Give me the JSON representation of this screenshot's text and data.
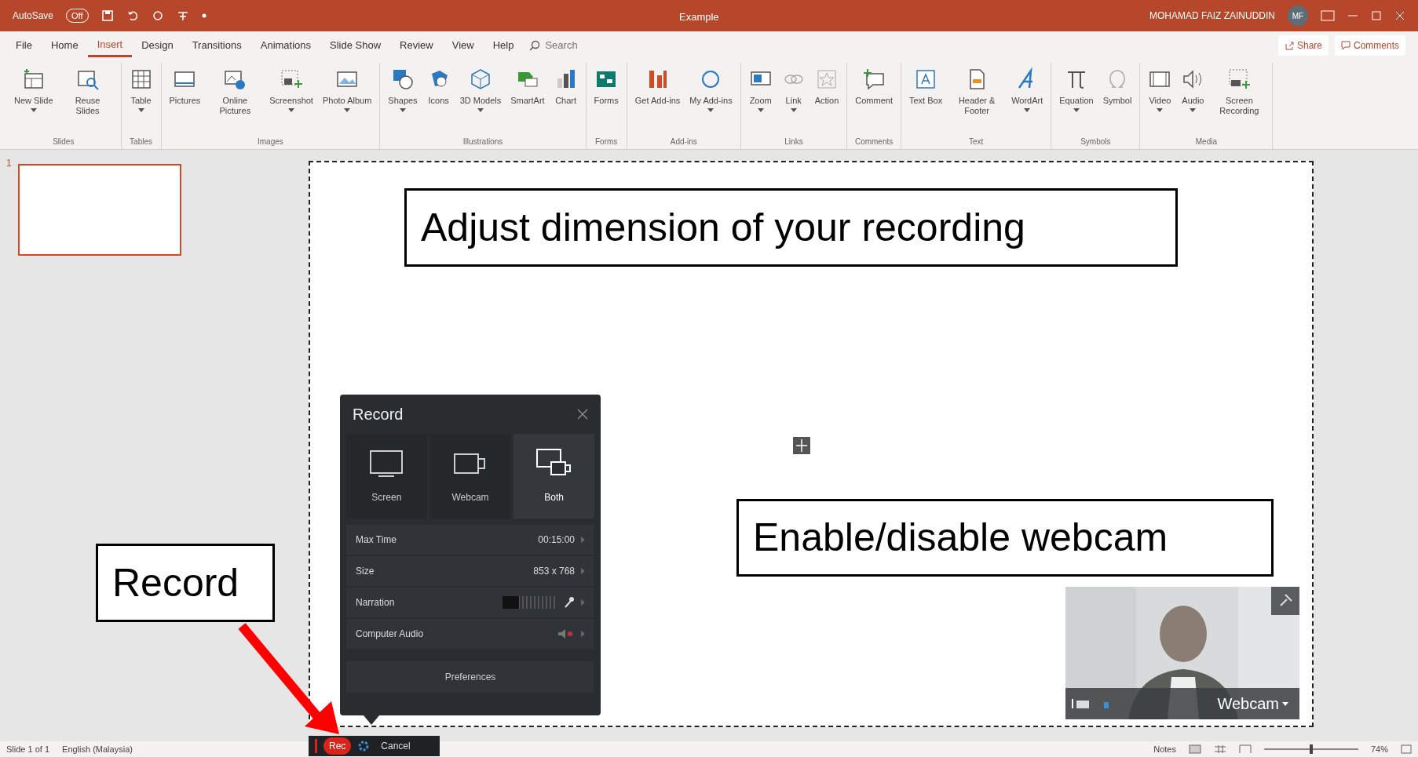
{
  "title_bar": {
    "autosave_label": "AutoSave",
    "autosave_toggle": {
      "label": "Off",
      "on": false
    },
    "document_title": "Example",
    "user_name": "MOHAMAD FAIZ ZAINUDDIN",
    "user_initials": "MF"
  },
  "menu_tabs": [
    {
      "label": "File",
      "selected": false
    },
    {
      "label": "Home",
      "selected": false
    },
    {
      "label": "Insert",
      "selected": true
    },
    {
      "label": "Design",
      "selected": false
    },
    {
      "label": "Transitions",
      "selected": false
    },
    {
      "label": "Animations",
      "selected": false
    },
    {
      "label": "Slide Show",
      "selected": false
    },
    {
      "label": "Review",
      "selected": false
    },
    {
      "label": "View",
      "selected": false
    },
    {
      "label": "Help",
      "selected": false
    }
  ],
  "search": {
    "placeholder": "Search"
  },
  "share_button": "Share",
  "comments_button": "Comments",
  "ribbon_groups": [
    {
      "label": "Slides",
      "buttons": [
        {
          "label": "New Slide",
          "kind": "slide",
          "dropdown": true
        },
        {
          "label": "Reuse Slides",
          "kind": "reuse",
          "dropdown": false
        }
      ]
    },
    {
      "label": "Tables",
      "buttons": [
        {
          "label": "Table",
          "kind": "table",
          "dropdown": true
        }
      ]
    },
    {
      "label": "Images",
      "buttons": [
        {
          "label": "Pictures",
          "kind": "picture",
          "dropdown": false
        },
        {
          "label": "Online Pictures",
          "kind": "online",
          "dropdown": false
        },
        {
          "label": "Screenshot",
          "kind": "screenshot",
          "dropdown": true
        },
        {
          "label": "Photo Album",
          "kind": "album",
          "dropdown": true
        }
      ]
    },
    {
      "label": "Illustrations",
      "buttons": [
        {
          "label": "Shapes",
          "kind": "shapes",
          "dropdown": true
        },
        {
          "label": "Icons",
          "kind": "icons",
          "dropdown": false
        },
        {
          "label": "3D Models",
          "kind": "cube",
          "dropdown": true
        },
        {
          "label": "SmartArt",
          "kind": "smartart",
          "dropdown": false
        },
        {
          "label": "Chart",
          "kind": "chart",
          "dropdown": false
        }
      ]
    },
    {
      "label": "Forms",
      "buttons": [
        {
          "label": "Forms",
          "kind": "forms",
          "dropdown": false
        }
      ]
    },
    {
      "label": "Add-ins",
      "buttons": [
        {
          "label": "Get Add-ins",
          "kind": "store",
          "dropdown": false
        },
        {
          "label": "My Add-ins",
          "kind": "addin",
          "dropdown": true
        }
      ]
    },
    {
      "label": "Links",
      "buttons": [
        {
          "label": "Zoom",
          "kind": "zoom",
          "dropdown": true
        },
        {
          "label": "Link",
          "kind": "link",
          "dropdown": true
        },
        {
          "label": "Action",
          "kind": "action",
          "dropdown": false
        }
      ]
    },
    {
      "label": "Comments",
      "buttons": [
        {
          "label": "Comment",
          "kind": "comment",
          "dropdown": false
        }
      ]
    },
    {
      "label": "Text",
      "buttons": [
        {
          "label": "Text Box",
          "kind": "textbox",
          "dropdown": false
        },
        {
          "label": "Header & Footer",
          "kind": "header",
          "dropdown": false
        },
        {
          "label": "WordArt",
          "kind": "wordart",
          "dropdown": true
        }
      ]
    },
    {
      "label": "Symbols",
      "buttons": [
        {
          "label": "Equation",
          "kind": "equation",
          "dropdown": true
        },
        {
          "label": "Symbol",
          "kind": "symbol",
          "dropdown": false
        }
      ]
    },
    {
      "label": "Media",
      "buttons": [
        {
          "label": "Video",
          "kind": "video",
          "dropdown": true
        },
        {
          "label": "Audio",
          "kind": "audio",
          "dropdown": true
        },
        {
          "label": "Screen Recording",
          "kind": "screenrec",
          "dropdown": false
        }
      ]
    }
  ],
  "slides_pane": {
    "thumbnails": [
      {
        "number": "1",
        "selected": true
      }
    ]
  },
  "annotations": [
    {
      "text": "Adjust dimension of your recording"
    },
    {
      "text": "Enable/disable webcam"
    },
    {
      "text": "Record"
    }
  ],
  "record_panel": {
    "title": "Record",
    "modes": [
      {
        "label": "Screen",
        "kind": "screen",
        "selected": false
      },
      {
        "label": "Webcam",
        "kind": "webcam",
        "selected": false
      },
      {
        "label": "Both",
        "kind": "both",
        "selected": true
      }
    ],
    "settings": [
      {
        "kind": "value",
        "label": "Max Time",
        "value": "00:15:00"
      },
      {
        "kind": "value",
        "label": "Size",
        "value": "853 x 768"
      },
      {
        "kind": "meter",
        "label": "Narration",
        "level": 0.3
      },
      {
        "kind": "speaker",
        "label": "Computer Audio",
        "muted": true
      }
    ],
    "preferences_button": "Preferences"
  },
  "record_bar": {
    "rec_button": "Rec",
    "cancel_button": "Cancel"
  },
  "webcam": {
    "label": "Webcam"
  },
  "status_bar": {
    "slide_info": "Slide 1 of 1",
    "language": "English (Malaysia)",
    "notes_button": "Notes",
    "zoom": {
      "level": 0.5,
      "reading": "74%"
    }
  }
}
